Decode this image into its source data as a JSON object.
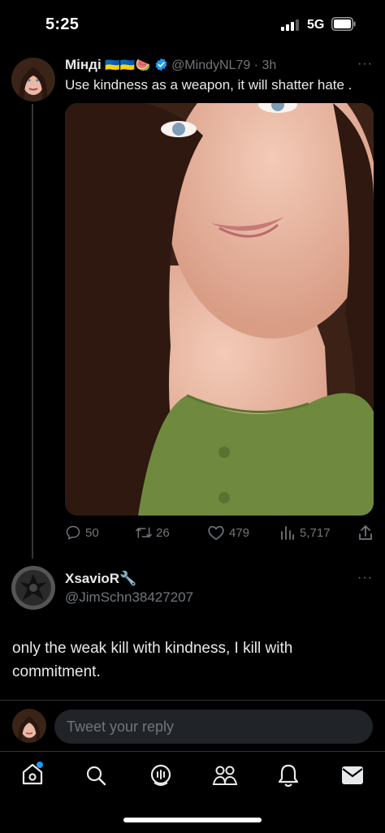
{
  "status": {
    "time": "5:25",
    "network": "5G"
  },
  "tweet": {
    "author_name": "Мінді",
    "author_flags": "🇺🇦🇺🇦🍉",
    "handle_time": "@MindyNL79 · 3h",
    "more": "···",
    "text": "Use kindness as a weapon, it will shatter hate .",
    "stats": {
      "replies": "50",
      "retweets": "26",
      "likes": "479",
      "views": "5,717"
    }
  },
  "reply": {
    "author_name": "XsavioR🔧",
    "handle": "@JimSchn38427207",
    "more": "···",
    "text_line1": "only the weak kill with kindness, I kill with",
    "text_line2": "commitment."
  },
  "compose": {
    "placeholder": "Tweet your reply"
  },
  "colors": {
    "accent": "#1d9bf0",
    "verified": "#1d9bf0",
    "muted": "#71767b"
  },
  "tab_icons": [
    "home-icon",
    "search-icon",
    "spaces-icon",
    "communities-icon",
    "notifications-icon",
    "messages-icon"
  ]
}
